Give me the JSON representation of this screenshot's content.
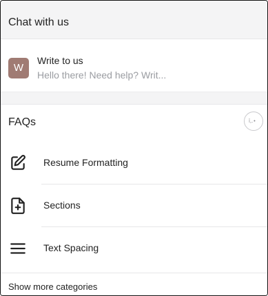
{
  "chat": {
    "title": "Chat with us",
    "conversation": {
      "avatar_letter": "W",
      "avatar_color": "#a07b73",
      "name": "Write to us",
      "preview": "Hello there! Need help? Writ..."
    }
  },
  "faqs": {
    "title": "FAQs",
    "loading_icon": "loading-dots-icon",
    "items": [
      {
        "label": "Resume Formatting",
        "icon": "edit-icon"
      },
      {
        "label": "Sections",
        "icon": "add-file-icon"
      },
      {
        "label": "Text Spacing",
        "icon": "menu-icon"
      }
    ],
    "show_more_label": "Show more categories"
  }
}
